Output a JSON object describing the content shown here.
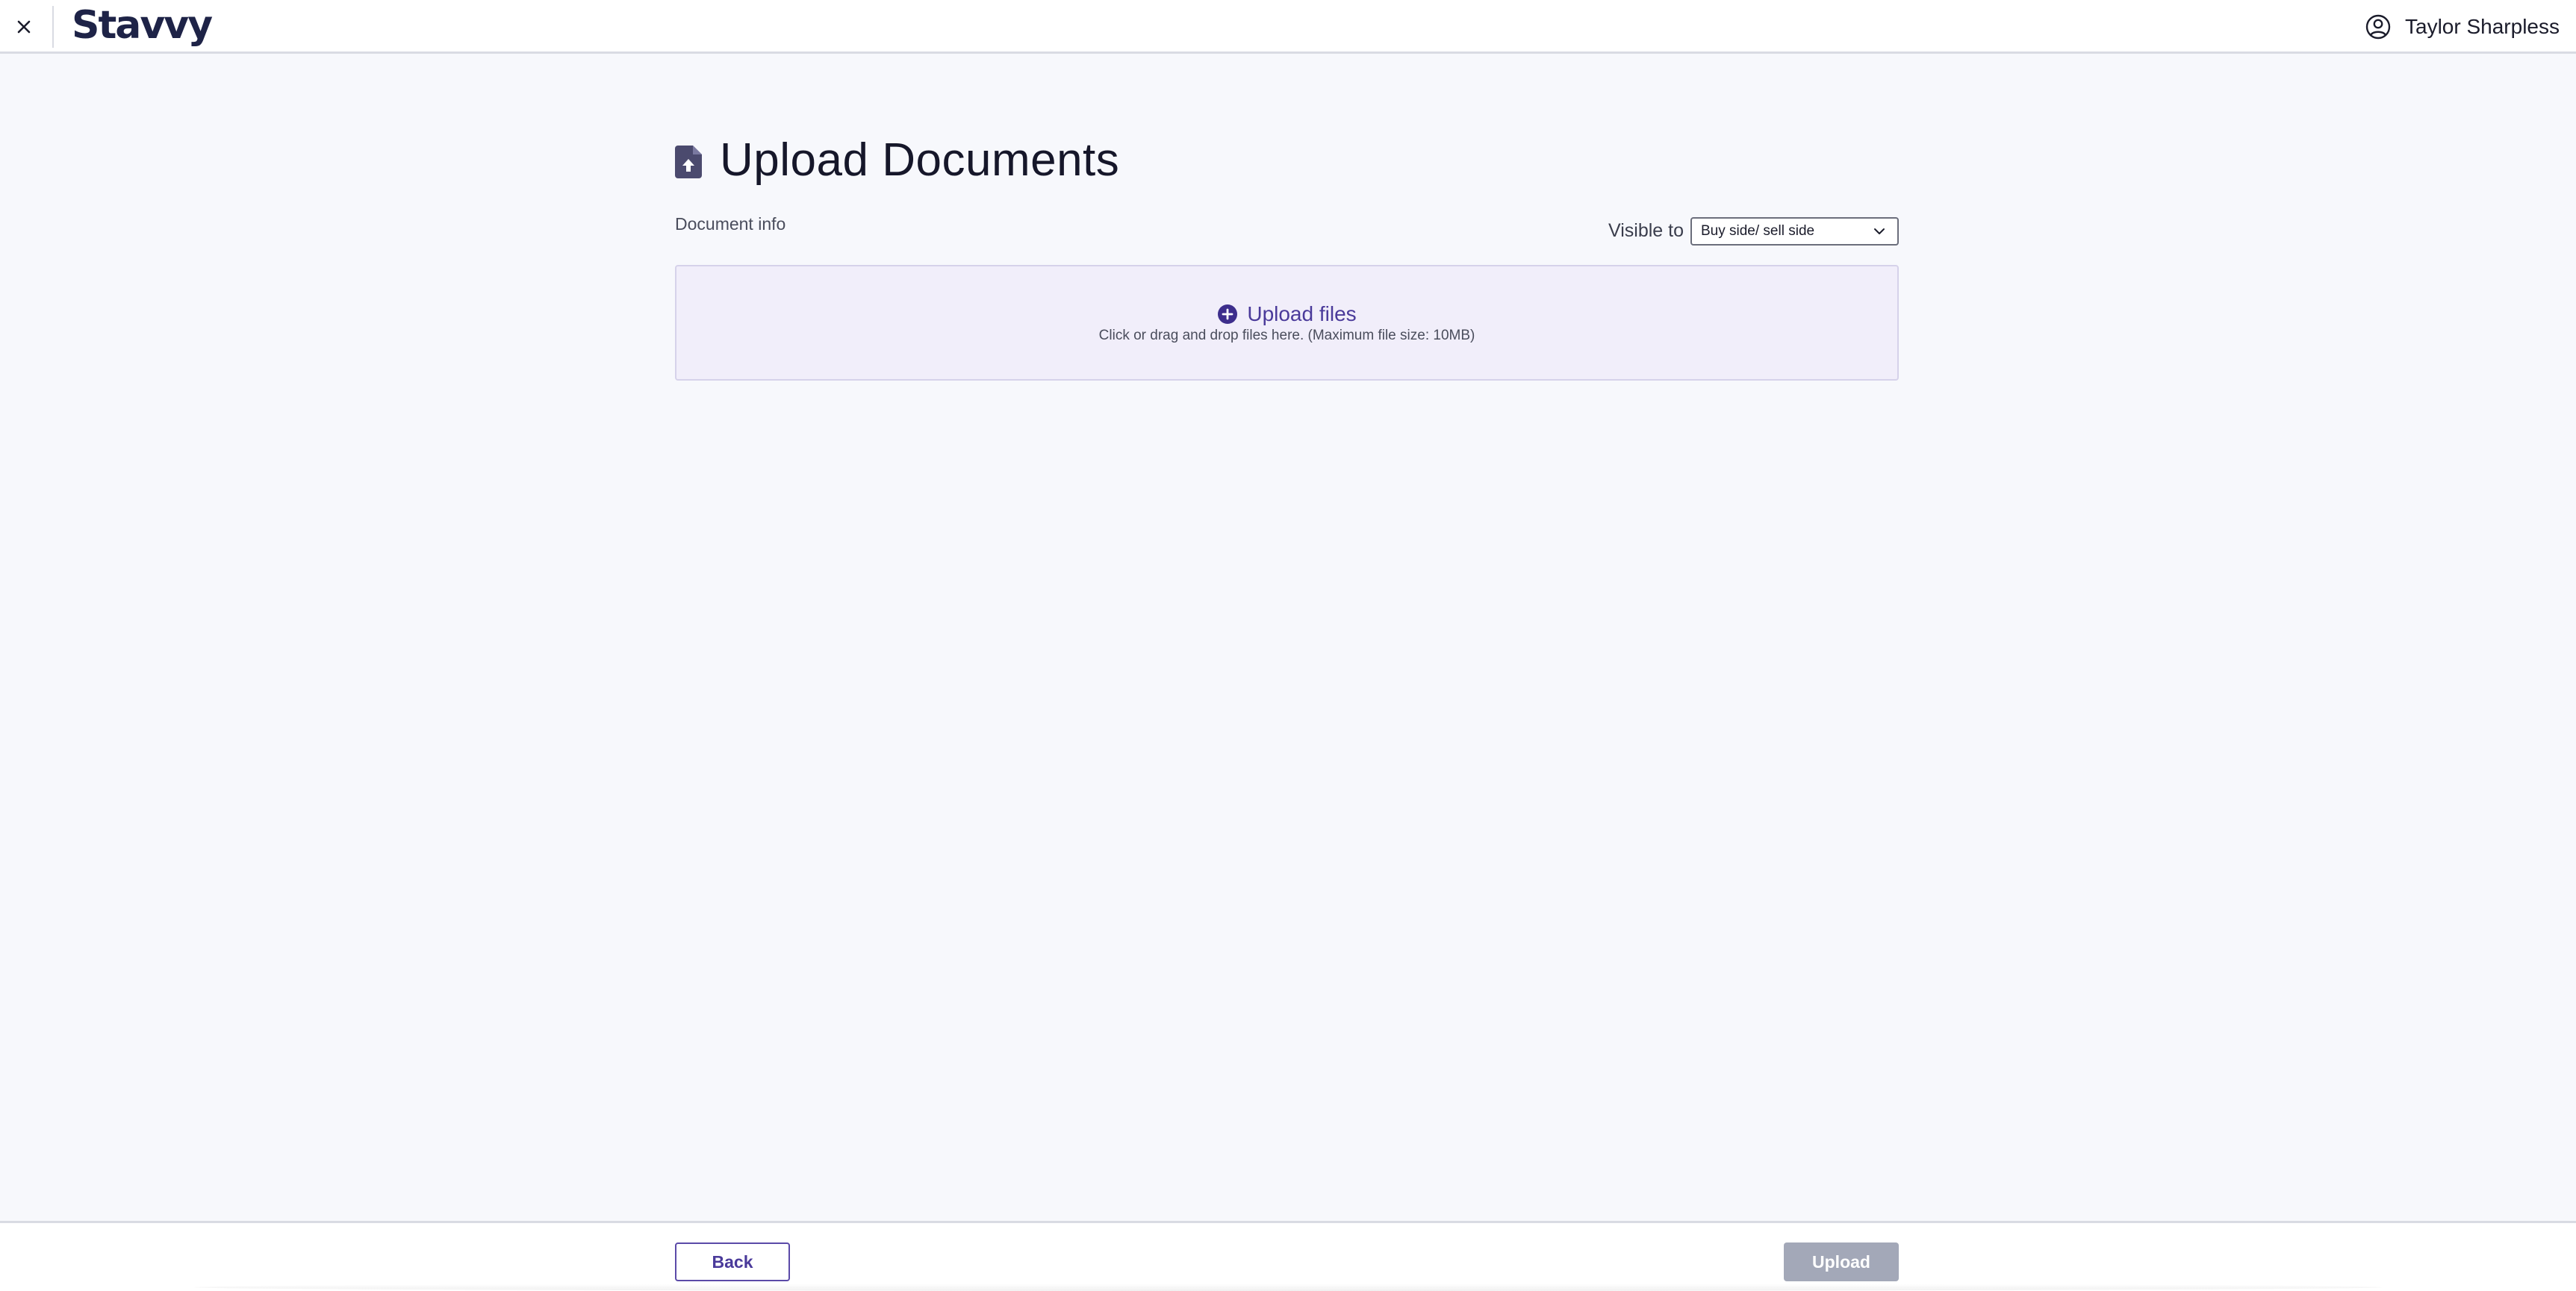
{
  "header": {
    "logo_text": "Stavvy",
    "close_icon": "close-icon",
    "user": {
      "icon": "user-circle-icon",
      "name": "Taylor Sharpless"
    }
  },
  "main": {
    "title": "Upload Documents",
    "title_icon": "file-upload-icon",
    "section_label": "Document info",
    "visibility": {
      "label": "Visible to",
      "selected": "Buy side/ sell side"
    },
    "dropzone": {
      "icon": "plus-circle-icon",
      "title": "Upload files",
      "hint": "Click or drag and drop files here. (Maximum file size: 10MB)"
    }
  },
  "footer": {
    "back_label": "Back",
    "upload_label": "Upload",
    "upload_enabled": false
  },
  "colors": {
    "accent": "#4a3a9a",
    "brand_dark": "#1e2347",
    "dropzone_bg": "#f1eefa",
    "page_bg": "#f7f8fc",
    "disabled_button": "#a3a8b8"
  }
}
